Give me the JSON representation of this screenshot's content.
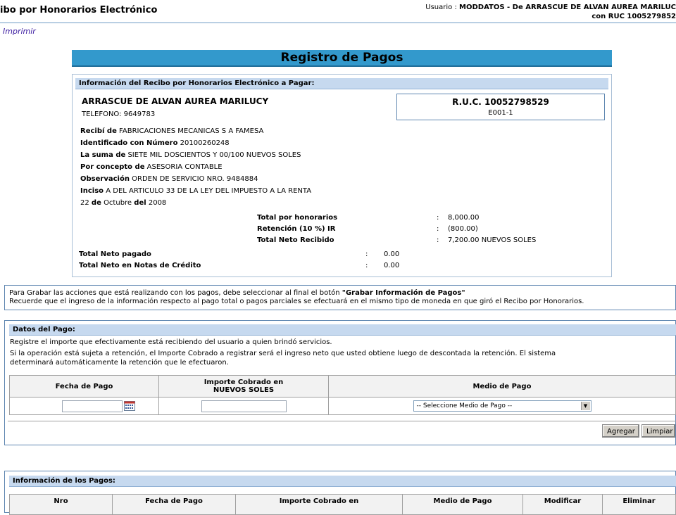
{
  "header": {
    "app_title": "ibo por Honorarios Electrónico",
    "user_line1_prefix": "Usuario :",
    "user_line1_value": "MODDATOS - De ARRASCUE DE ALVAN AUREA MARILUC",
    "user_line2": "con RUC 1005279852"
  },
  "print_link": "Imprimir",
  "page_title": "Registro de Pagos",
  "recibo": {
    "section_title": "Información del Recibo por Honorarios Electrónico a Pagar:",
    "emisor_name": "ARRASCUE DE ALVAN AUREA MARILUCY",
    "telefono": "TELEFONO: 9649783",
    "ruc": "R.U.C. 10052798529",
    "serie": "E001-1",
    "recibi_label": "Recibí de",
    "recibi_value": "FABRICACIONES MECANICAS S A FAMESA",
    "identificado_label": "Identificado con Número",
    "identificado_value": "20100260248",
    "suma_label": "La suma de",
    "suma_value": "SIETE MIL DOSCIENTOS Y 00/100 NUEVOS SOLES",
    "concepto_label": "Por concepto de",
    "concepto_value": "ASESORIA CONTABLE",
    "observacion_label": "Observación",
    "observacion_value": "ORDEN DE SERVICIO NRO. 9484884",
    "inciso_label": "Inciso",
    "inciso_value": "A DEL ARTICULO 33 DE LA LEY DEL IMPUESTO A LA RENTA",
    "fecha_day": "22",
    "fecha_de1": "de",
    "fecha_month": "Octubre",
    "fecha_del": "del",
    "fecha_year": "2008",
    "totals": [
      {
        "label": "Total por honorarios",
        "value": "8,000.00"
      },
      {
        "label": "Retención (10 %) IR",
        "value": "(800.00)"
      },
      {
        "label": "Total Neto Recibido",
        "value": "7,200.00 NUEVOS SOLES"
      }
    ],
    "neto_pagado_label": "Total Neto pagado",
    "neto_pagado_value": "0.00",
    "neto_notas_label": "Total Neto en Notas de Crédito",
    "neto_notas_value": "0.00",
    "colon": ":"
  },
  "notice": {
    "line1_prefix": "Para Grabar las acciones que está realizando con los pagos, debe seleccionar al final el botón",
    "line1_bold": "\"Grabar Información de Pagos\"",
    "line2": "Recuerde que el ingreso de la información respecto al pago total o pagos parciales se efectuará en el mismo tipo de moneda en que giró el Recibo por Honorarios."
  },
  "datos_pago": {
    "section_title": "Datos del Pago:",
    "text1": "Registre el importe que efectivamente está recibiendo del usuario a quien brindó servicios.",
    "text2": "Si la operación está sujeta a retención, el Importe Cobrado a registrar será el ingreso neto que usted obtiene luego de descontada la retención. El sistema",
    "text3": "determinará automáticamente la retención que le efectuaron.",
    "col_fecha": "Fecha de Pago",
    "col_importe_1": "Importe Cobrado en",
    "col_importe_2": "NUEVOS SOLES",
    "col_medio": "Medio de Pago",
    "fecha_value": "",
    "importe_value": "",
    "medio_selected": "-- Seleccione Medio de Pago --",
    "btn_agregar": "Agregar",
    "btn_limpiar": "Limpiar"
  },
  "info_pagos": {
    "section_title": "Información de los Pagos:",
    "col1": "Nro",
    "col2": "Fecha de Pago",
    "col3": "Importe Cobrado en",
    "col4": "Medio de Pago",
    "col5": "Modificar",
    "col6": "Eliminar"
  },
  "colors": {
    "title_bar": "#3399cc",
    "section_bar": "#c6d9ef",
    "border": "#5e86b0",
    "link": "#3a1aa0"
  }
}
